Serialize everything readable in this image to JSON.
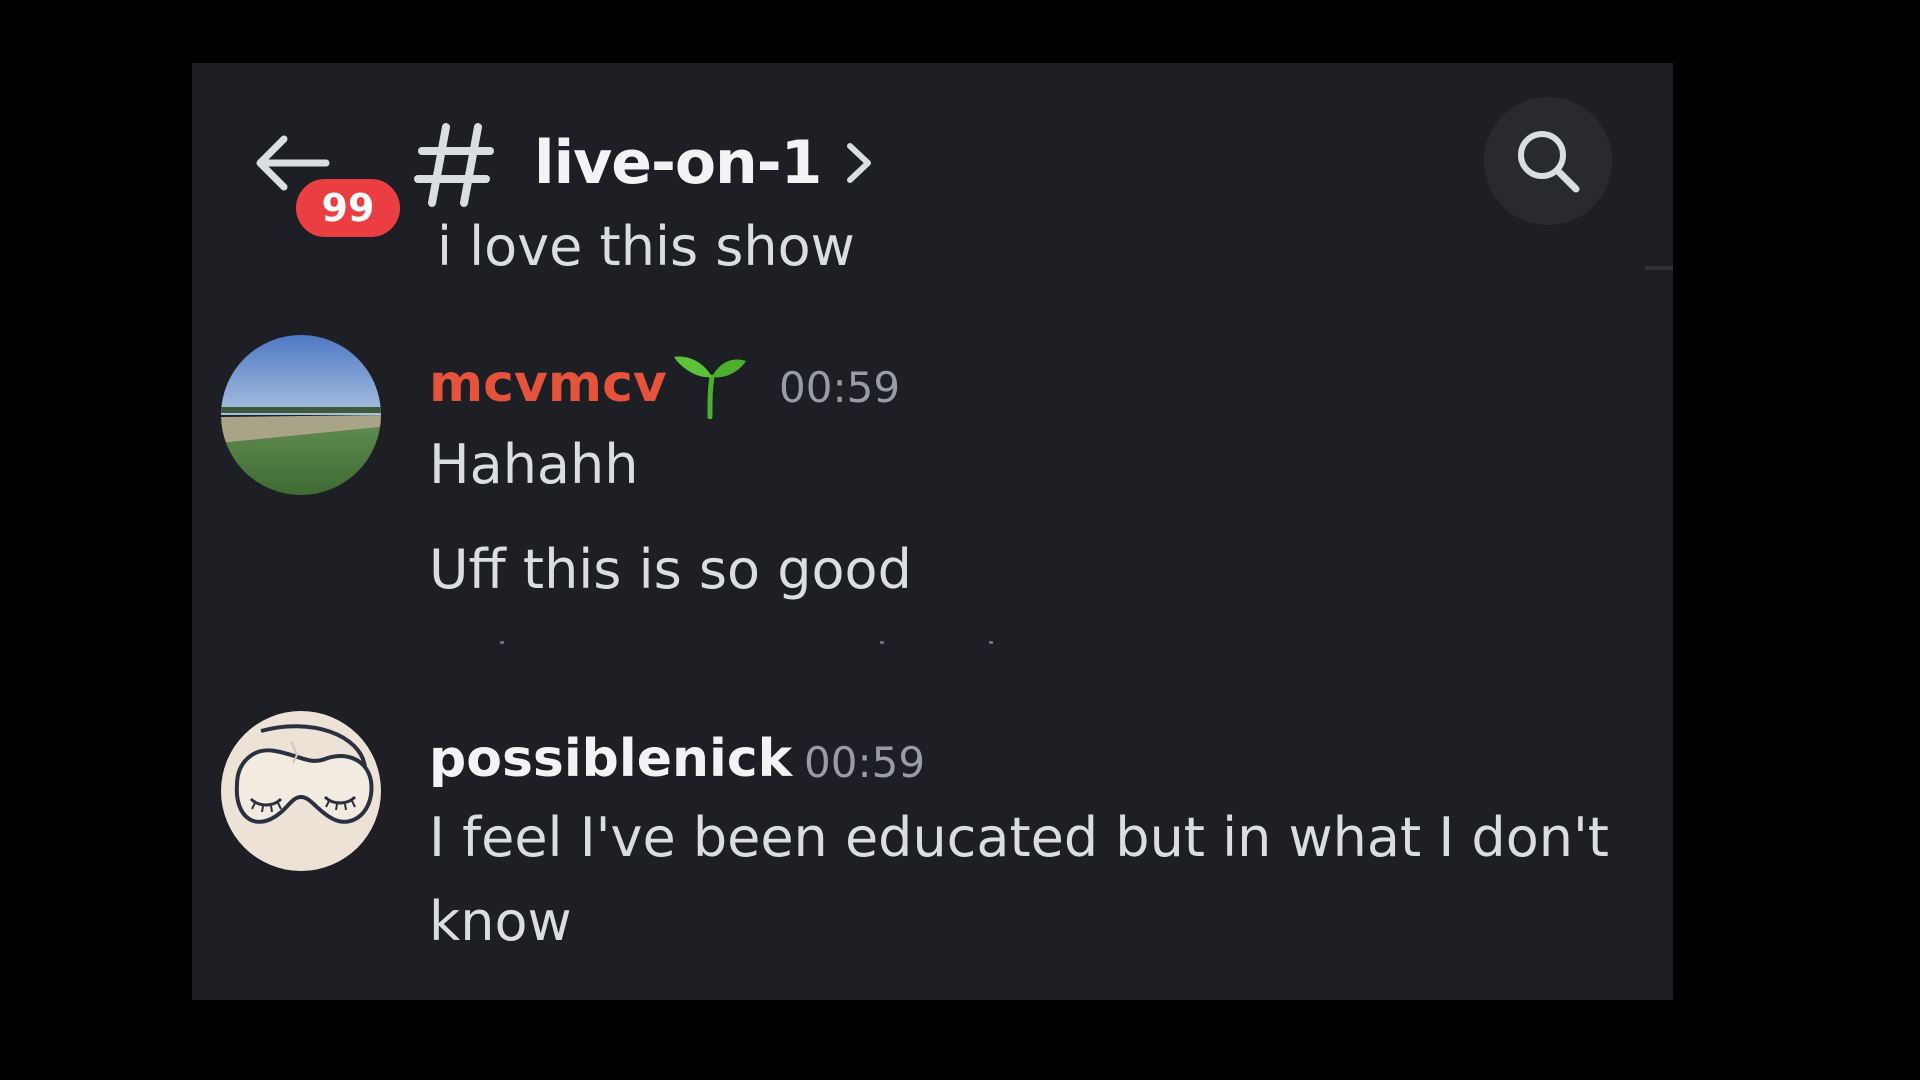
{
  "header": {
    "back_icon": "arrow-left-icon",
    "unread_badge": "99",
    "channel_icon": "hash-icon",
    "channel_name": "live-on-1",
    "chevron_icon": "chevron-right-icon",
    "search_icon": "search-icon"
  },
  "partial_message": {
    "text": "i love this show"
  },
  "messages": [
    {
      "author": "mcvmcv",
      "author_color": "#e5533d",
      "author_badge_icon": "sprout-icon",
      "timestamp": "00:59",
      "avatar_icon": "field-landscape-avatar",
      "lines": [
        "Hahahh",
        "Uff this is so good"
      ]
    },
    {
      "author": "possiblenick",
      "author_color": "#f2f3f5",
      "timestamp": "00:59",
      "avatar_icon": "sleep-mask-avatar",
      "lines": [
        "I feel I've been educated but in what I don't know"
      ]
    }
  ],
  "colors": {
    "page_background": "#000000",
    "panel_background": "#1e1f24",
    "badge": "#ea3e43",
    "search_button": "#282a30",
    "text_primary": "#dbdee1",
    "text_muted": "#9a9ca3"
  }
}
